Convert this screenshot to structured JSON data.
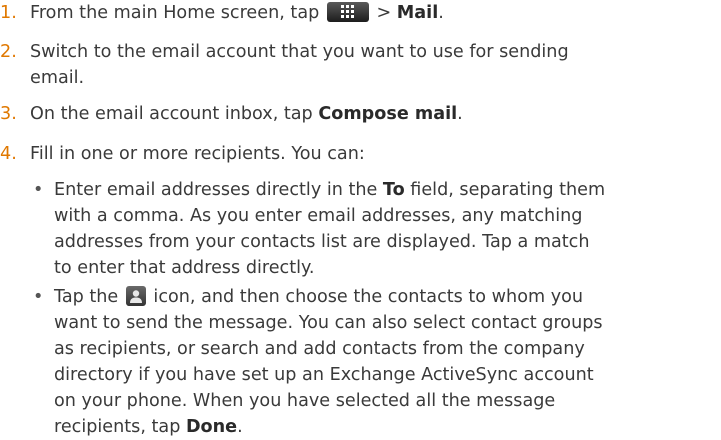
{
  "steps": [
    {
      "number": "1.",
      "parts": [
        "From the main Home screen, tap",
        "> ",
        "Mail",
        "."
      ]
    },
    {
      "number": "2.",
      "lines": [
        "Switch to the email account that you want to use for sending",
        "email."
      ]
    },
    {
      "number": "3.",
      "parts": [
        "On the email account inbox, tap ",
        "Compose mail",
        "."
      ]
    },
    {
      "number": "4.",
      "text": "Fill in one or more recipients. You can:"
    }
  ],
  "bullet_char": "•",
  "bullets": [
    {
      "line1_pre": "Enter email addresses directly in the ",
      "line1_bold": "To",
      "line1_post": " field, separating them",
      "lines": [
        "with a comma. As you enter email addresses, any matching",
        "addresses from your contacts list are displayed. Tap a match",
        "to enter that address directly."
      ]
    },
    {
      "line1_pre": "Tap the ",
      "line1_post": " icon, and then choose the contacts to whom you",
      "lines": [
        "want to send the message. You can also select contact groups",
        "as recipients, or search and add contacts from the company",
        "directory if you have set up an Exchange ActiveSync account",
        "on your phone. When you have selected all the message"
      ],
      "last_pre": "recipients, tap ",
      "last_bold": "Done",
      "last_post": "."
    }
  ],
  "icons": {
    "apps": "all-apps-icon",
    "contact": "contact-person-icon"
  },
  "colors": {
    "number": "#e07800",
    "text": "#3a3a3a"
  }
}
